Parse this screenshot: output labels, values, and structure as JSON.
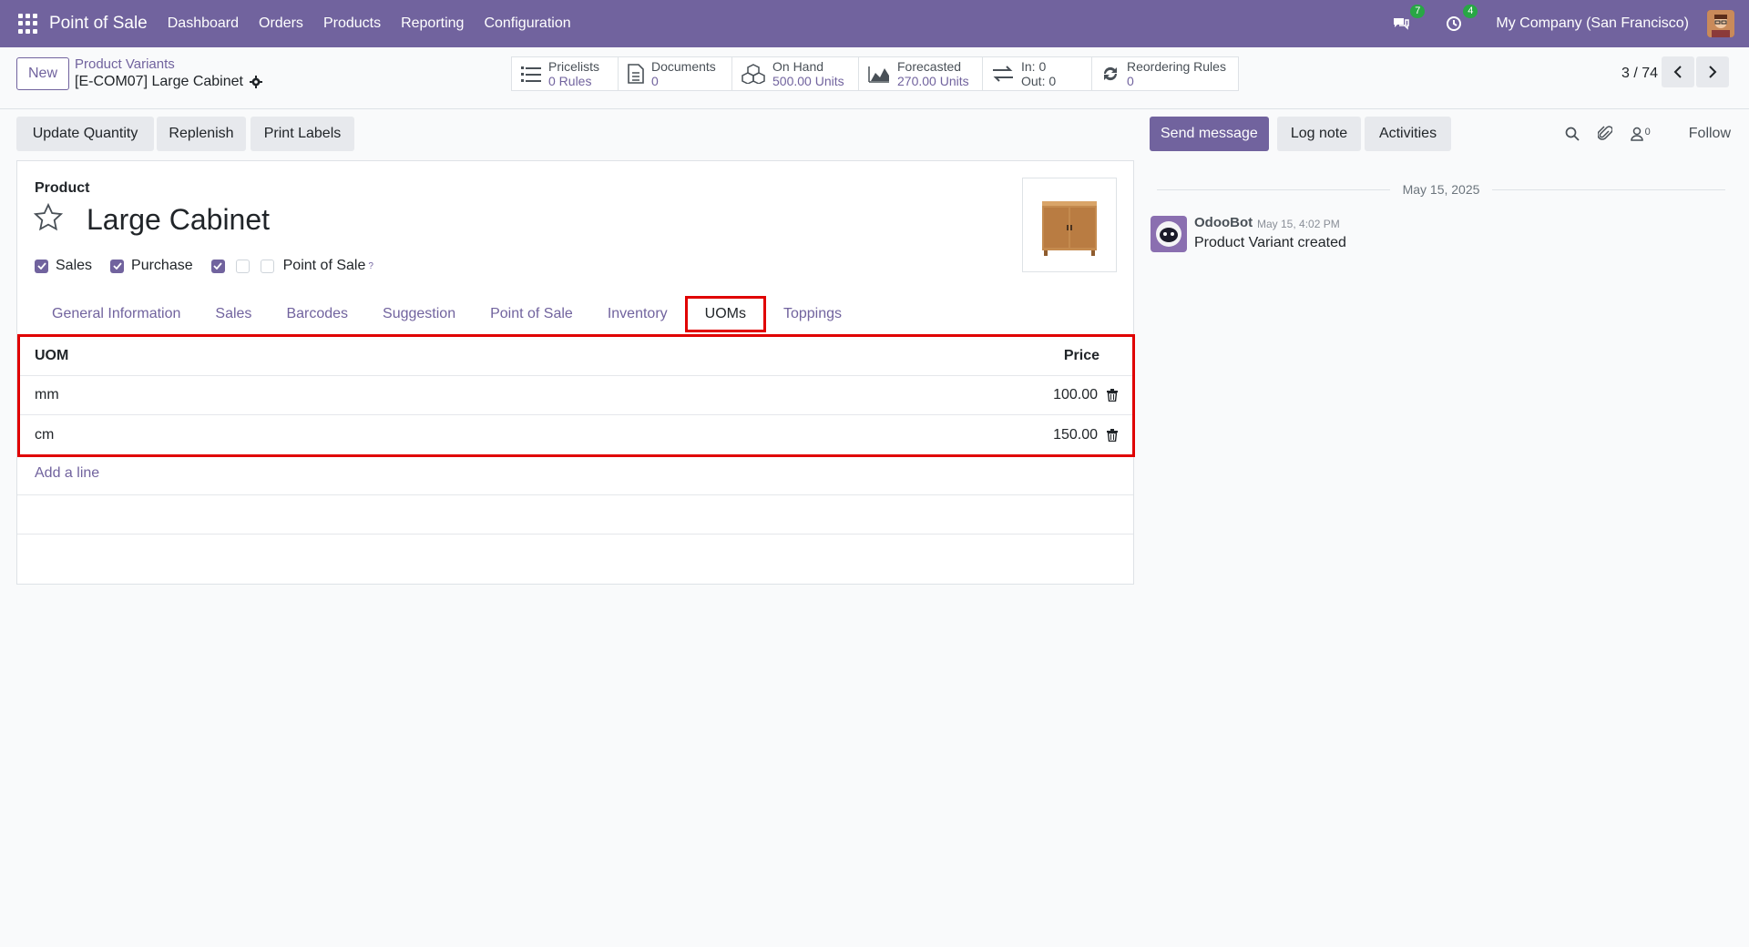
{
  "navbar": {
    "app_name": "Point of Sale",
    "menu": [
      "Dashboard",
      "Orders",
      "Products",
      "Reporting",
      "Configuration"
    ],
    "messages_count": "7",
    "activities_count": "4",
    "company": "My Company (San Francisco)"
  },
  "control": {
    "new_label": "New",
    "breadcrumb": "Product Variants",
    "record_name": "[E-COM07] Large Cabinet",
    "pager": "3 / 74"
  },
  "stats": [
    {
      "label": "Pricelists",
      "value": "0 Rules",
      "icon": "list-icon"
    },
    {
      "label": "Documents",
      "value": "0",
      "icon": "document-icon"
    },
    {
      "label": "On Hand",
      "value": "500.00 Units",
      "icon": "cubes-icon"
    },
    {
      "label": "Forecasted",
      "value": "270.00 Units",
      "icon": "area-chart-icon"
    },
    {
      "label": "In: 0",
      "value": "Out: 0",
      "icon": "exchange-icon"
    },
    {
      "label": "Reordering Rules",
      "value": "0",
      "icon": "refresh-icon"
    }
  ],
  "actions": {
    "update_quantity": "Update Quantity",
    "replenish": "Replenish",
    "print_labels": "Print Labels"
  },
  "chatter": {
    "send_message": "Send message",
    "log_note": "Log note",
    "activities": "Activities",
    "followers_count": "0",
    "follow": "Follow",
    "date": "May 15, 2025",
    "author": "OdooBot",
    "time": "May 15, 4:02 PM",
    "body": "Product Variant created"
  },
  "product": {
    "section_label": "Product",
    "name": "Large Cabinet",
    "sales_label": "Sales",
    "purchase_label": "Purchase",
    "pos_label": "Point of Sale",
    "help_mark": "?"
  },
  "tabs": [
    "General Information",
    "Sales",
    "Barcodes",
    "Suggestion",
    "Point of Sale",
    "Inventory",
    "UOMs",
    "Toppings"
  ],
  "uom_table": {
    "col_uom": "UOM",
    "col_price": "Price",
    "rows": [
      {
        "uom": "mm",
        "price": "100.00"
      },
      {
        "uom": "cm",
        "price": "150.00"
      }
    ],
    "add_line": "Add a line"
  },
  "colors": {
    "brand": "#71639e",
    "highlight": "#e00000",
    "badge": "#28a745"
  }
}
